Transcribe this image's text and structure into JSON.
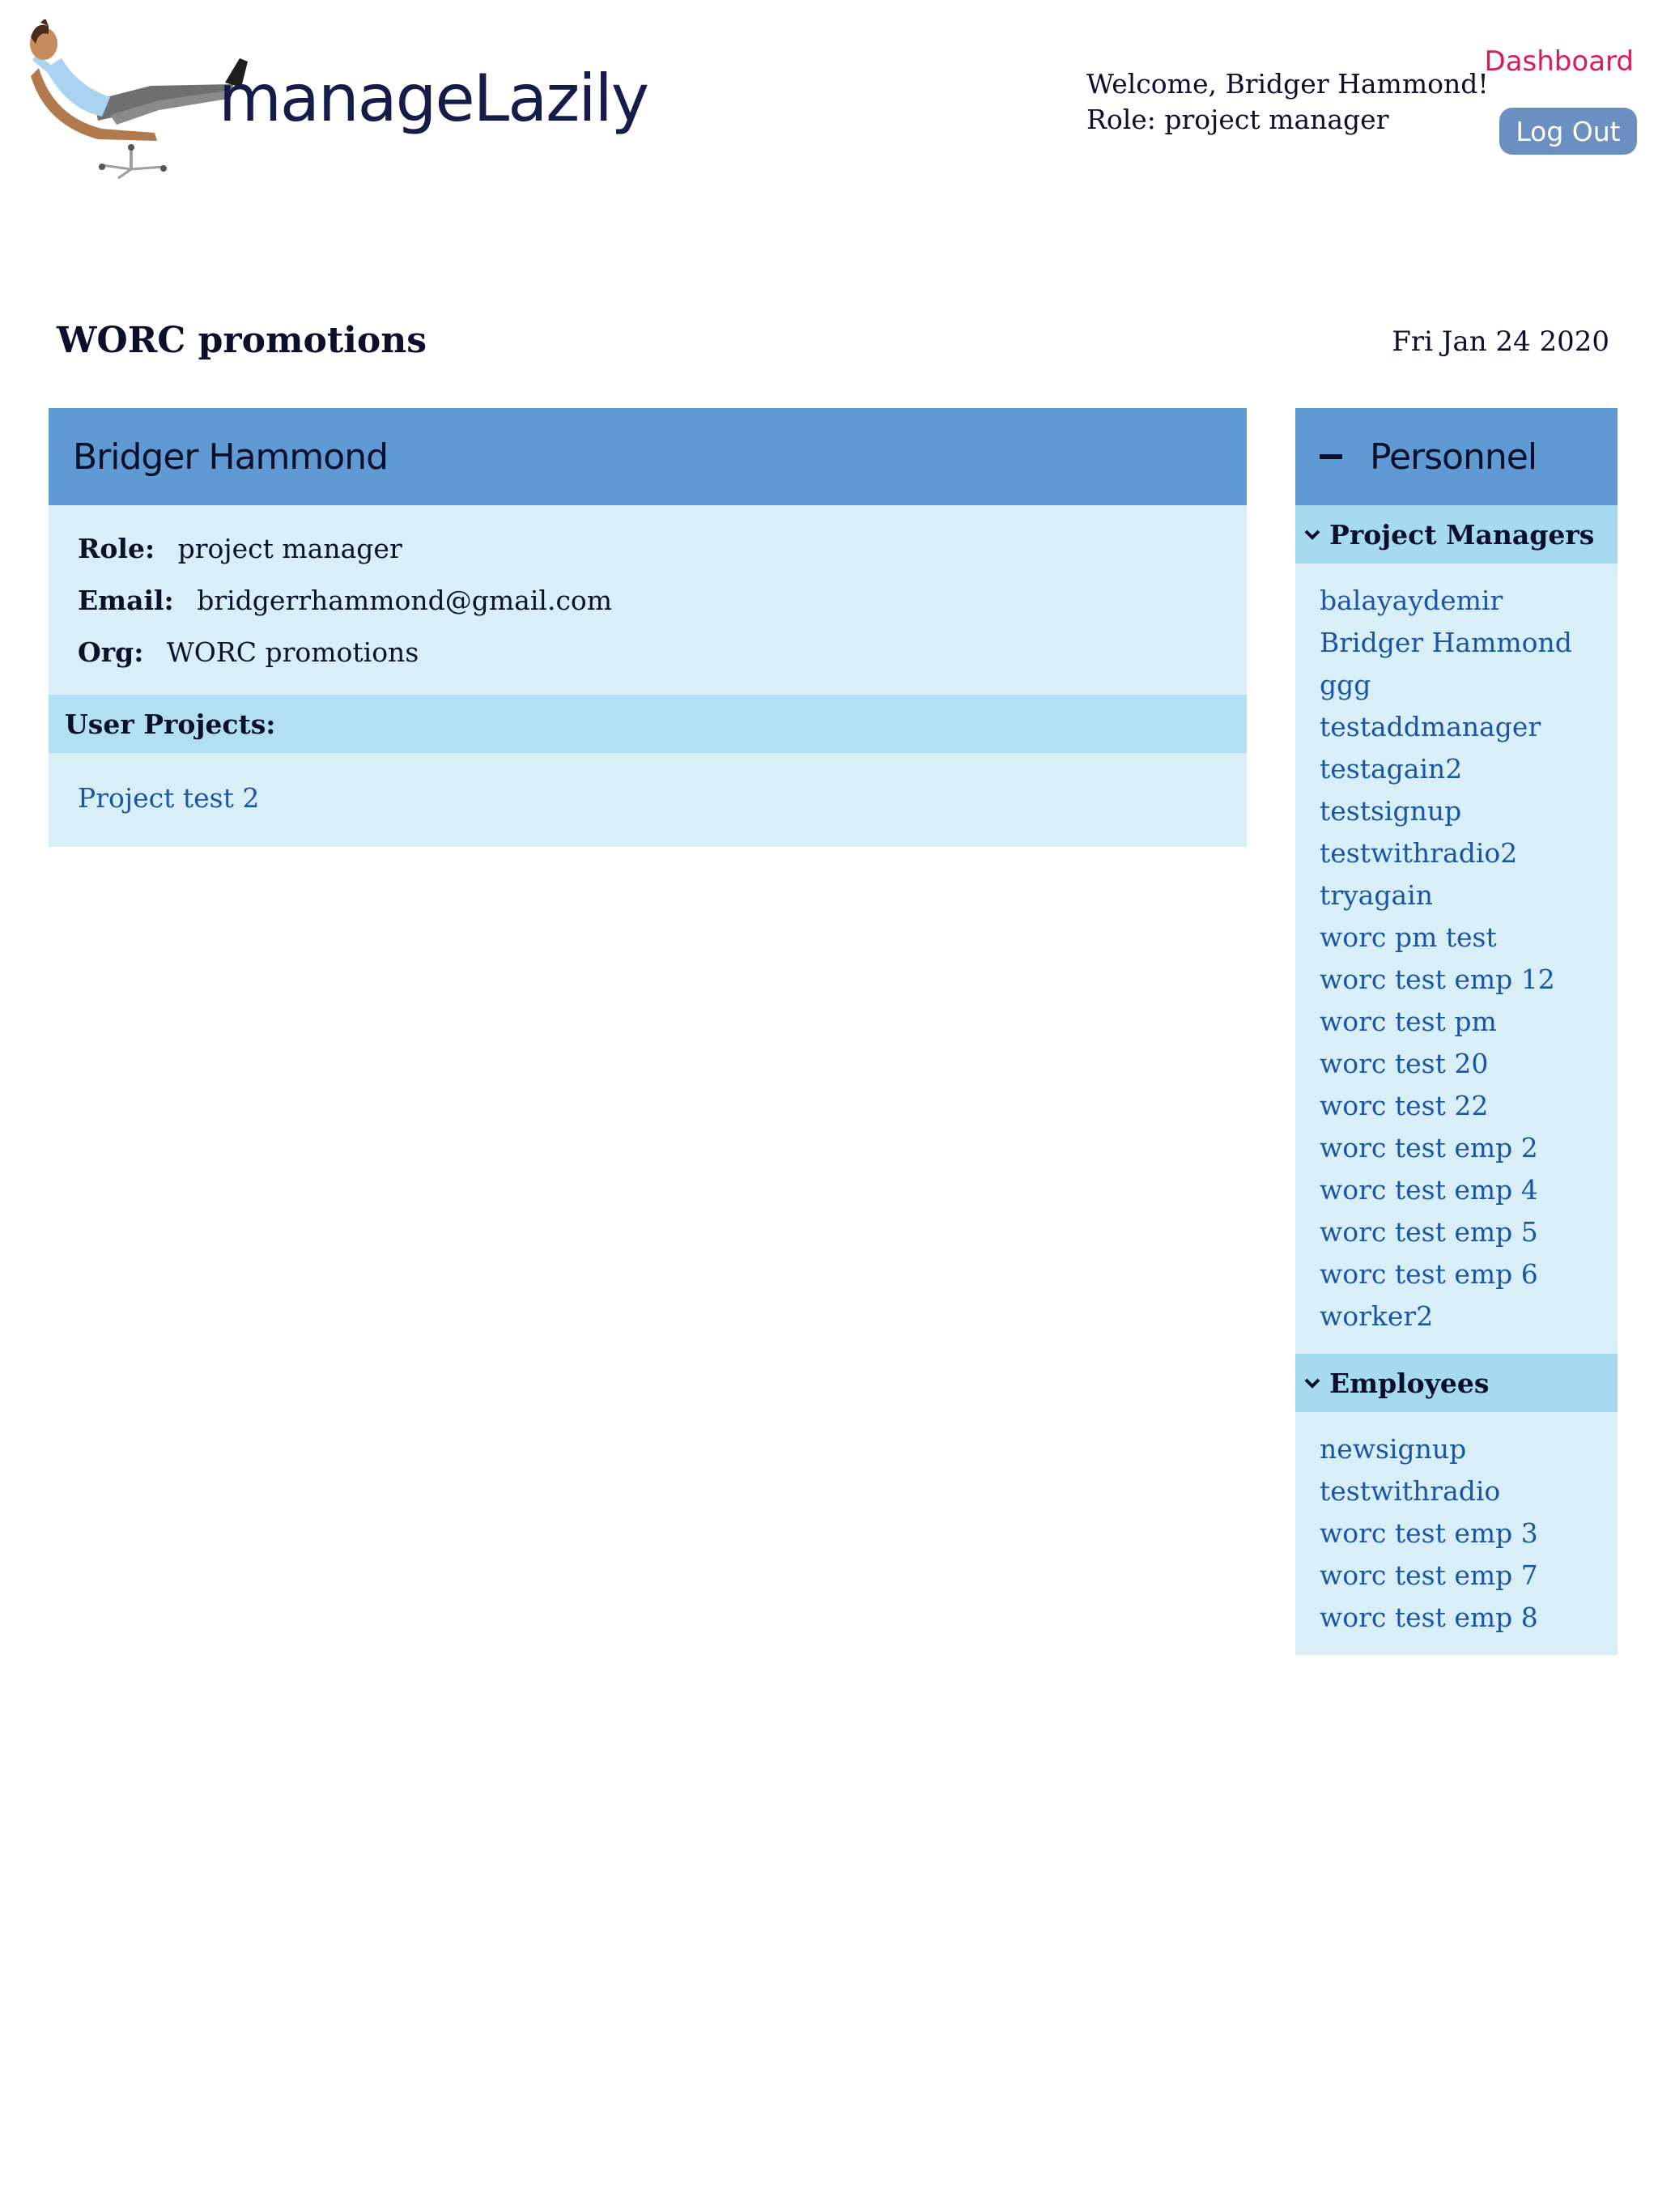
{
  "header": {
    "brand": "manageLazily",
    "logo_icon": "man-reclining-in-office-chair",
    "welcome_line": "Welcome, Bridger Hammond!",
    "role_line": "Role: project manager",
    "dashboard_link": "Dashboard",
    "logout_label": "Log Out"
  },
  "page": {
    "org_title": "WORC promotions",
    "date": "Fri Jan 24 2020"
  },
  "user_card": {
    "name": "Bridger Hammond",
    "role_label": "Role:",
    "role_value": "project manager",
    "email_label": "Email:",
    "email_value": "bridgerrhammond@gmail.com",
    "org_label": "Org:",
    "org_value": "WORC promotions",
    "projects_heading": "User Projects:",
    "projects": [
      "Project test 2"
    ]
  },
  "personnel": {
    "title": "Personnel",
    "collapse_icon": "minus-icon",
    "groups": [
      {
        "label": "Project Managers",
        "members": [
          "balayaydemir",
          "Bridger Hammond",
          "ggg",
          "testaddmanager",
          "testagain2",
          "testsignup",
          "testwithradio2",
          "tryagain",
          "worc pm test",
          "worc test emp 12",
          "worc test pm",
          "worc test 20",
          "worc test 22",
          "worc test emp 2",
          "worc test emp 4",
          "worc test emp 5",
          "worc test emp 6",
          "worker2"
        ]
      },
      {
        "label": "Employees",
        "members": [
          "newsignup",
          "testwithradio",
          "worc test emp 3",
          "worc test emp 7",
          "worc test emp 8"
        ]
      }
    ]
  },
  "colors": {
    "header_blue": "#5f9ad2",
    "panel_light": "#d8eff8",
    "section_blue": "#b2dff1",
    "link_blue": "#1b55a8",
    "dashboard_pink": "#d81b5a",
    "logout_bg": "#6b8fc0"
  }
}
